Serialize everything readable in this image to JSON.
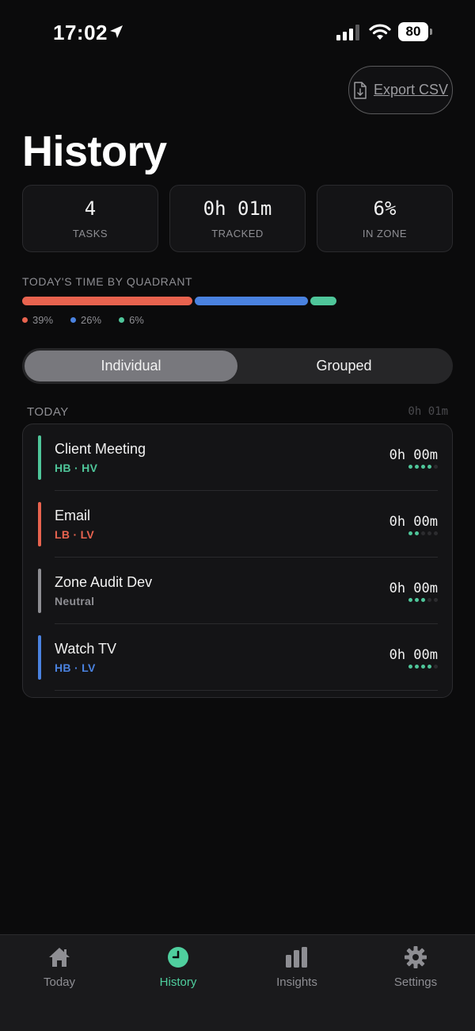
{
  "status_bar": {
    "time": "17:02",
    "battery": "80"
  },
  "header": {
    "export_label": "Export CSV",
    "title": "History"
  },
  "stats": [
    {
      "value": "4",
      "label": "TASKS"
    },
    {
      "value": "0h 01m",
      "label": "TRACKED"
    },
    {
      "value": "6%",
      "label": "IN ZONE"
    }
  ],
  "quadrant": {
    "title": "TODAY'S TIME BY QUADRANT",
    "legend": [
      {
        "label": "39%",
        "color": "#e8634f"
      },
      {
        "label": "26%",
        "color": "#4a82e0"
      },
      {
        "label": "6%",
        "color": "#4fc69a"
      }
    ]
  },
  "segmented": {
    "individual": "Individual",
    "grouped": "Grouped",
    "selected": "Individual"
  },
  "section": {
    "label": "TODAY",
    "total": "0h 01m"
  },
  "tasks": [
    {
      "name": "Client Meeting",
      "meta": "HB · HV",
      "time": "0h 00m",
      "accent": "#4fc69a",
      "meta_color": "#4fc69a",
      "dots_filled": 4,
      "dots_total": 5
    },
    {
      "name": "Email",
      "meta": "LB · LV",
      "time": "0h 00m",
      "accent": "#e8634f",
      "meta_color": "#e8634f",
      "dots_filled": 2,
      "dots_total": 5
    },
    {
      "name": "Zone Audit Dev",
      "meta": "Neutral",
      "time": "0h 00m",
      "accent": "#8e8e93",
      "meta_color": "#8e8e93",
      "dots_filled": 3,
      "dots_total": 5
    },
    {
      "name": "Watch TV",
      "meta": "HB · LV",
      "time": "0h 00m",
      "accent": "#4a82e0",
      "meta_color": "#4a82e0",
      "dots_filled": 4,
      "dots_total": 5
    }
  ],
  "tab_bar": {
    "today": "Today",
    "history": "History",
    "insights": "Insights",
    "settings": "Settings",
    "active": "History",
    "active_color": "#4fcf9e"
  }
}
